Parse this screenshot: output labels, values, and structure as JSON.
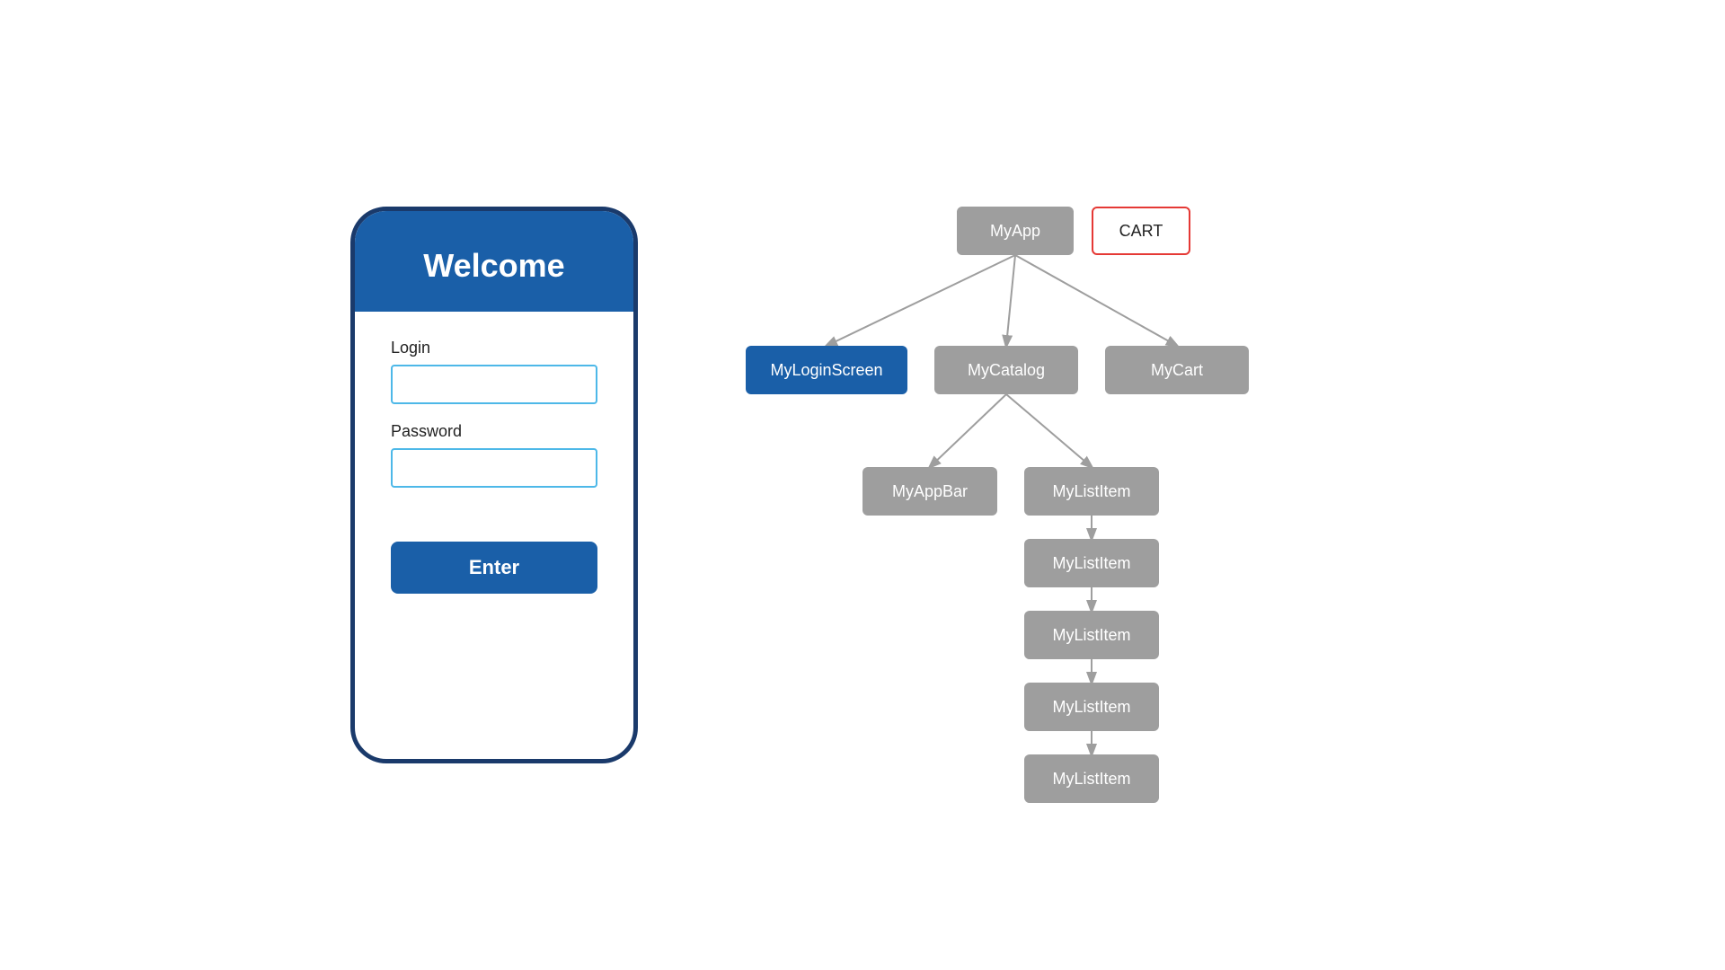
{
  "phone": {
    "header": "Welcome",
    "login_label": "Login",
    "login_placeholder": "",
    "password_label": "Password",
    "password_placeholder": "",
    "enter_button": "Enter"
  },
  "tree": {
    "myapp_label": "MyApp",
    "cart_label": "CART",
    "login_screen_label": "MyLoginScreen",
    "catalog_label": "MyCatalog",
    "mycart_label": "MyCart",
    "appbar_label": "MyAppBar",
    "listitem1_label": "MyListItem",
    "listitem2_label": "MyListItem",
    "listitem3_label": "MyListItem",
    "listitem4_label": "MyListItem",
    "listitem5_label": "MyListItem"
  }
}
